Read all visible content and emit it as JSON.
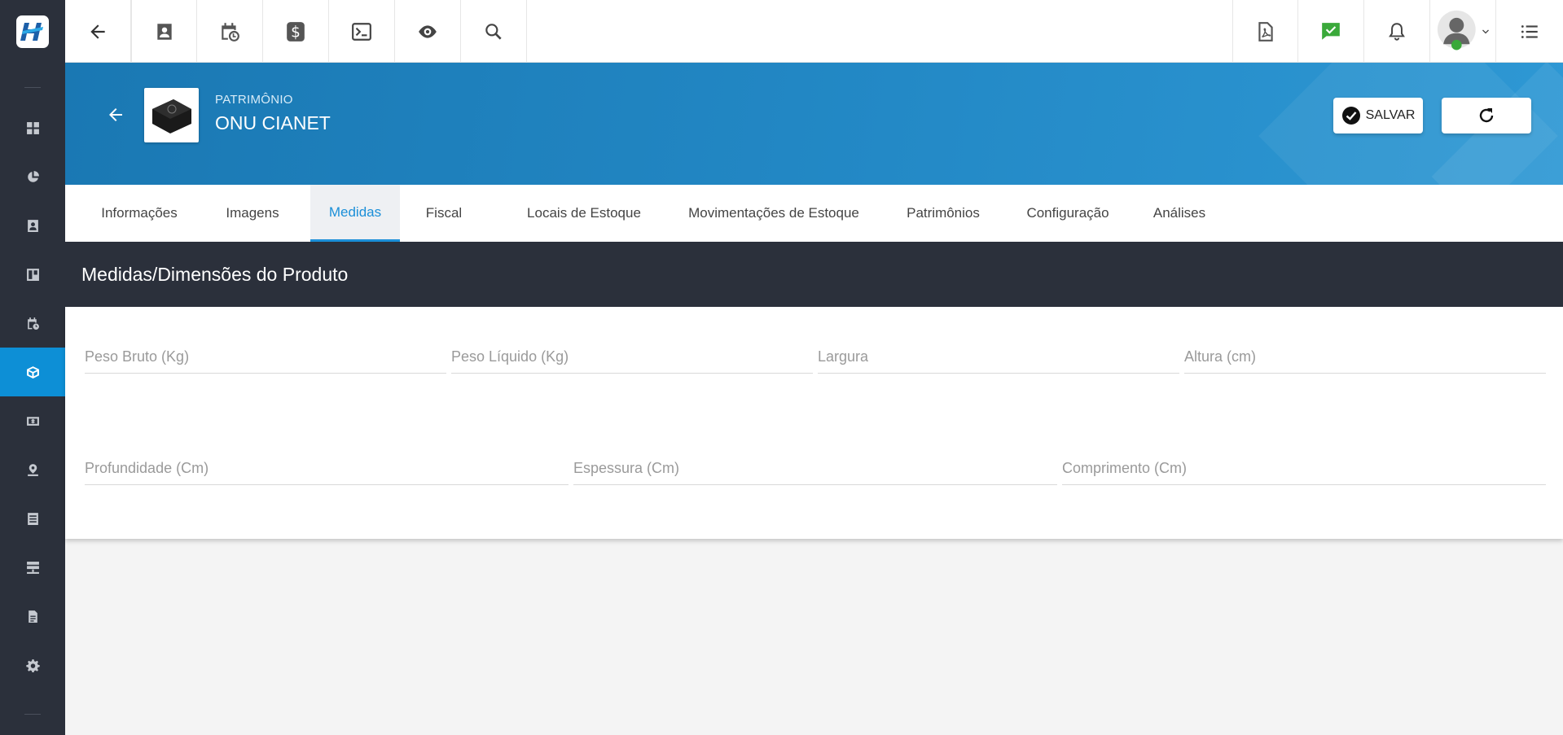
{
  "sidebar": {
    "items": [
      {
        "icon": "dashboard-icon"
      },
      {
        "icon": "pie-chart-icon"
      },
      {
        "icon": "contact-card-icon"
      },
      {
        "icon": "board-icon"
      },
      {
        "icon": "calendar-clock-icon"
      },
      {
        "icon": "package-icon",
        "active": true
      },
      {
        "icon": "money-icon"
      },
      {
        "icon": "map-pin-icon"
      },
      {
        "icon": "list-document-icon"
      },
      {
        "icon": "server-icon"
      },
      {
        "icon": "file-icon"
      },
      {
        "icon": "gear-icon"
      }
    ]
  },
  "topbar": {
    "left_icons": [
      "back-arrow-icon",
      "contact-card-icon",
      "calendar-clock-icon",
      "dollar-icon",
      "terminal-icon",
      "eye-icon",
      "search-icon"
    ],
    "right_icons": [
      "pdf-icon",
      "checked-message-icon",
      "bell-icon",
      "user-avatar",
      "menu-list-icon"
    ]
  },
  "header": {
    "breadcrumb": "PATRIMÔNIO",
    "title": "ONU CIANET",
    "save_label": "SALVAR"
  },
  "tabs": [
    {
      "label": "Informações"
    },
    {
      "label": "Imagens"
    },
    {
      "label": "Medidas",
      "active": true
    },
    {
      "label": "Fiscal"
    },
    {
      "label": "Locais de Estoque"
    },
    {
      "label": "Movimentações de Estoque"
    },
    {
      "label": "Patrimônios"
    },
    {
      "label": "Configuração"
    },
    {
      "label": "Análises"
    }
  ],
  "section": {
    "title": "Medidas/Dimensões do Produto"
  },
  "form": {
    "peso_bruto": {
      "placeholder": "Peso Bruto (Kg)",
      "value": ""
    },
    "peso_liquido": {
      "placeholder": "Peso Líquido (Kg)",
      "value": ""
    },
    "largura": {
      "placeholder": "Largura",
      "value": ""
    },
    "altura": {
      "placeholder": "Altura (cm)",
      "value": ""
    },
    "profundidade": {
      "placeholder": "Profundidade (Cm)",
      "value": ""
    },
    "espessura": {
      "placeholder": "Espessura (Cm)",
      "value": ""
    },
    "comprimento": {
      "placeholder": "Comprimento (Cm)",
      "value": ""
    }
  },
  "colors": {
    "sidebar_bg": "#2b303b",
    "accent": "#0d8fd6",
    "banner": "#2389c6",
    "chat_check": "#3aa93a"
  }
}
